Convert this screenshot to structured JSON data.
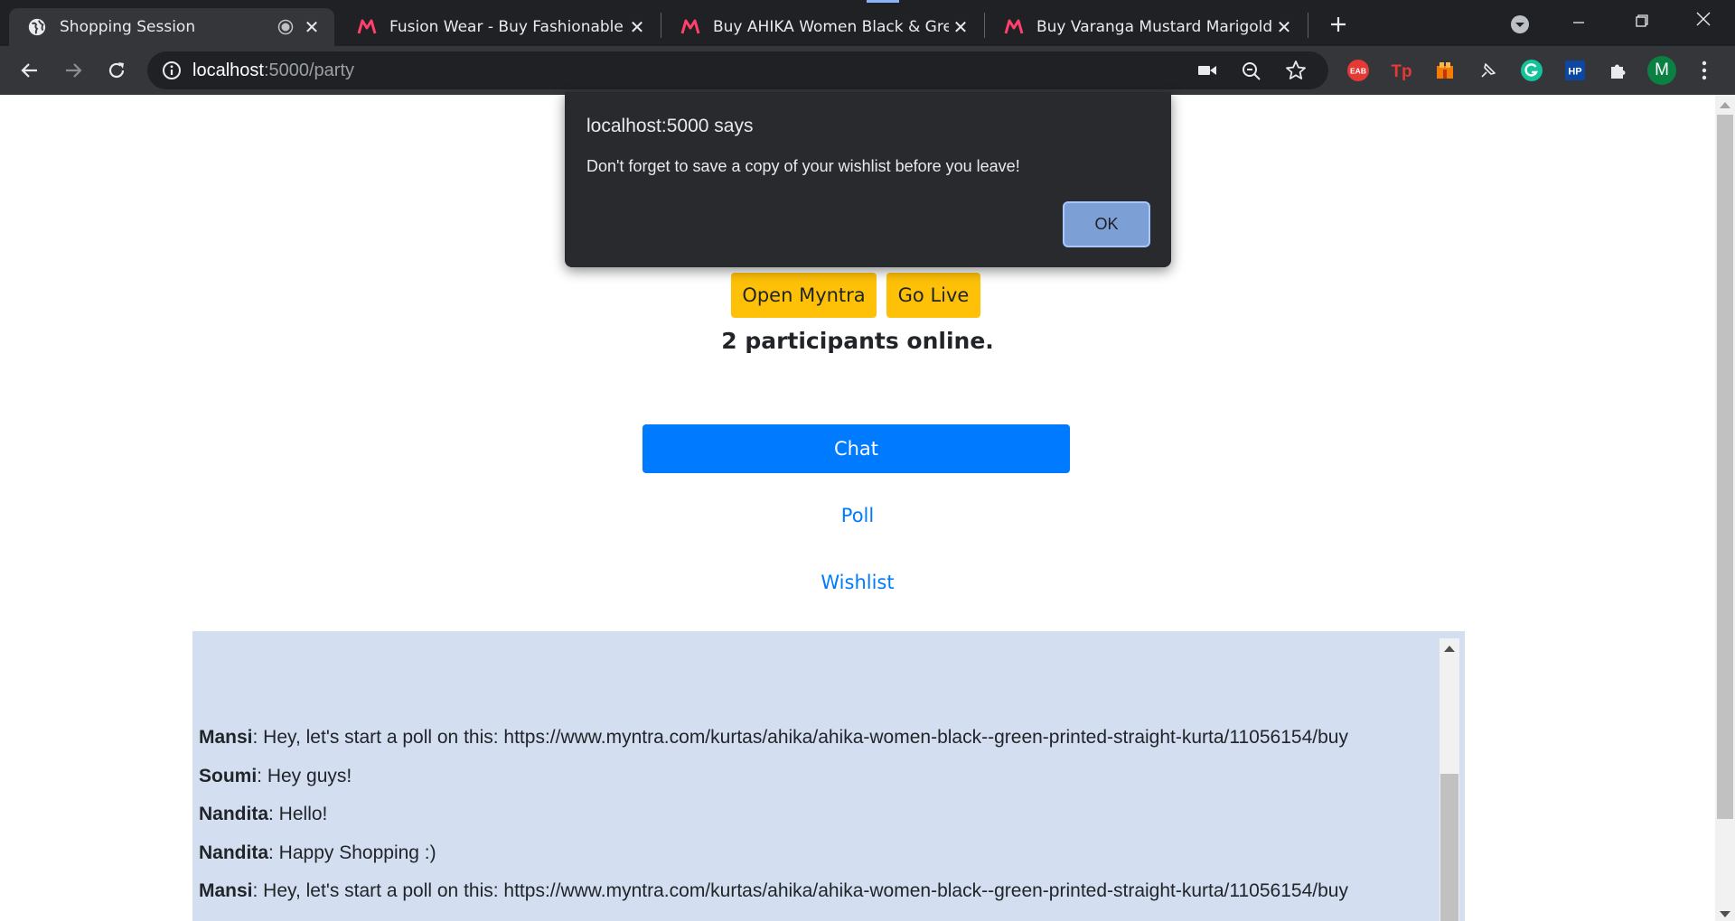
{
  "browser": {
    "tabs": [
      {
        "title": "Shopping Session",
        "active": true,
        "icon": "globe-icon"
      },
      {
        "title": "Fusion Wear - Buy Fashionable Et",
        "active": false,
        "icon": "myntra-icon"
      },
      {
        "title": "Buy AHIKA Women Black & Green",
        "active": false,
        "icon": "myntra-icon"
      },
      {
        "title": "Buy Varanga Mustard Marigold C",
        "active": false,
        "icon": "myntra-icon"
      }
    ],
    "address": {
      "host": "localhost",
      "rest": ":5000/party"
    },
    "profile_initial": "M",
    "extensions": [
      {
        "name": "eab-extension-icon",
        "label": "EAB",
        "color": "#e53935"
      },
      {
        "name": "tp-extension-icon",
        "label": "Tp",
        "color": "#e53935"
      },
      {
        "name": "orange-extension-icon",
        "label": "",
        "color": "#f57c00"
      },
      {
        "name": "pin-extension-icon",
        "label": "",
        "color": "#e8eaed"
      },
      {
        "name": "grammarly-icon",
        "label": "G",
        "color": "#15c39a"
      },
      {
        "name": "hp-extension-icon",
        "label": "HP",
        "color": "#0d47a1"
      }
    ]
  },
  "page": {
    "open_myntra_label": "Open Myntra",
    "go_live_label": "Go Live",
    "participants_text": "2 participants online.",
    "chat_label": "Chat",
    "poll_label": "Poll",
    "wishlist_label": "Wishlist",
    "messages": [
      {
        "user": "Mansi",
        "text": ": Hey, let's start a poll on this: https://www.myntra.com/kurtas/ahika/ahika-women-black--green-printed-straight-kurta/11056154/buy"
      },
      {
        "user": "Soumi",
        "text": ": Hey guys!"
      },
      {
        "user": "Nandita",
        "text": ": Hello!"
      },
      {
        "user": "Nandita",
        "text": ": Happy Shopping :)"
      },
      {
        "user": "Mansi",
        "text": ": Hey, let's start a poll on this: https://www.myntra.com/kurtas/ahika/ahika-women-black--green-printed-straight-kurta/11056154/buy"
      }
    ]
  },
  "dialog": {
    "title": "localhost:5000 says",
    "message": "Don't forget to save a copy of your wishlist before you leave!",
    "ok_label": "OK"
  },
  "colors": {
    "accent_yellow": "#ffc107",
    "primary_blue": "#007bff",
    "chat_background": "#d3dff0",
    "myntra_pink": "#ff3f6c"
  }
}
